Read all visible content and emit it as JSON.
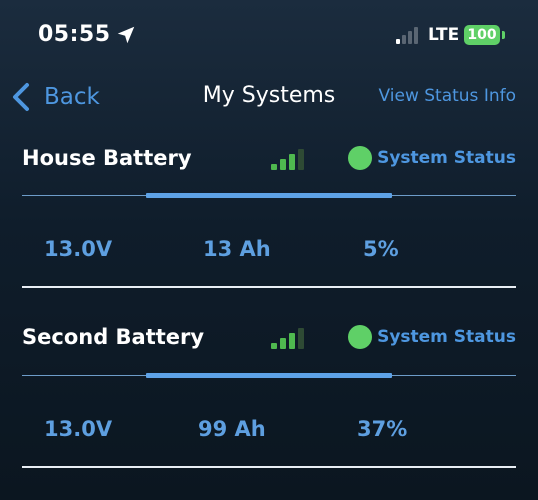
{
  "status_bar": {
    "time": "05:55",
    "network": "LTE",
    "battery_level": "100",
    "signal_bars_active": 1,
    "location_icon": "location-arrow-icon"
  },
  "nav": {
    "back_label": "Back",
    "title": "My Systems",
    "right_link": "View Status Info",
    "back_icon": "chevron-left-icon"
  },
  "systems": [
    {
      "name": "House Battery",
      "signal_bars_active": 3,
      "status_label": "System Status",
      "status_color": "#5fd067",
      "voltage": "13.0V",
      "capacity": "13 Ah",
      "percent": "5%"
    },
    {
      "name": "Second Battery",
      "signal_bars_active": 3,
      "status_label": "System Status",
      "status_color": "#5fd067",
      "voltage": "13.0V",
      "capacity": "99 Ah",
      "percent": "37%"
    }
  ],
  "colors": {
    "accent": "#4e97e0",
    "status_green": "#5fd067",
    "signal_active": "#4fb94f",
    "signal_inactive": "#2e4a34"
  }
}
